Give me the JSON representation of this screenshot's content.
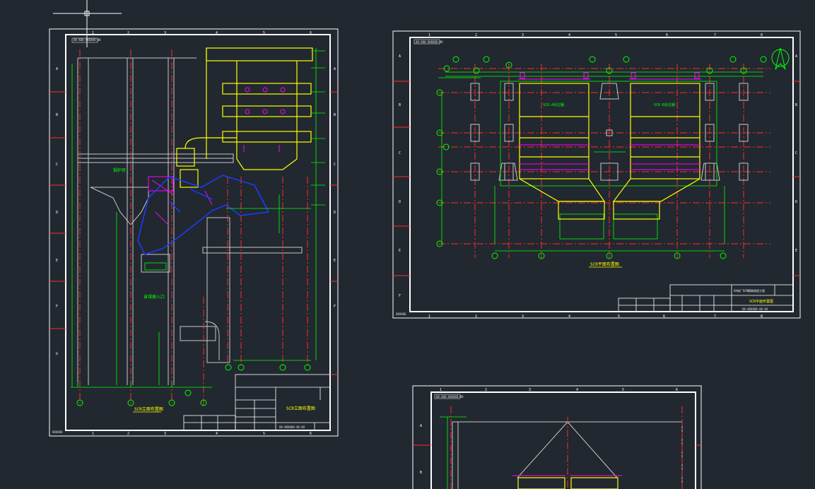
{
  "colors": {
    "background": "#212830",
    "frame": "#ffffff",
    "dimension": "#00ff00",
    "centerline": "#ff2a2a",
    "structure": "#ffff00",
    "duct": "#1e3cff",
    "equipment": "#ff00ff",
    "detail": "#c8c8c8"
  },
  "sheet_left": {
    "drawing_no": "XX-XXX-XXXXXX-XX",
    "title": "SCR立面布置图",
    "label_room": "锅炉房",
    "label_inlet": "省煤器入口",
    "block_title": "SCR立面布置图",
    "block_no": "XX-XXXXXX-XX-XX",
    "corner_note": "XXXXXX",
    "col_numbers": [
      "1",
      "2",
      "3",
      "4",
      "5",
      "6"
    ],
    "row_letters": [
      "A",
      "B",
      "C",
      "D",
      "E",
      "F",
      "G"
    ],
    "axis_bubbles": [
      "13",
      "12",
      "11",
      "10",
      "9",
      "8"
    ]
  },
  "sheet_right": {
    "drawing_no": "XX-XXX-XXXXXX-XX",
    "title": "SCR平面布置图",
    "reactor_a": "SCR-A反应器",
    "reactor_b": "SCR-B反应器",
    "block_project": "XX电厂SCR脱硝改造工程",
    "block_title": "SCR平面布置图",
    "block_no": "XX-XXXXXX-XX-XX",
    "col_numbers": [
      "1",
      "2",
      "3",
      "4",
      "5",
      "6",
      "7",
      "8"
    ],
    "row_letters": [
      "A",
      "B",
      "C",
      "D",
      "E",
      "F"
    ],
    "axis_top": [
      "15",
      "14",
      "13",
      "12",
      "11",
      "10"
    ],
    "axis_left": [
      "E",
      "D",
      "C",
      "B",
      "A"
    ],
    "axis_bottom": [
      "10",
      "11",
      "12",
      "13",
      "14"
    ],
    "corner_note": "XXXXXX"
  },
  "sheet_bottom": {
    "drawing_no": "XX-XXX-XXXXXX-XX",
    "col_numbers": [
      "1",
      "2",
      "3",
      "4",
      "5",
      "6"
    ],
    "row_letters": [
      "A",
      "B"
    ]
  }
}
